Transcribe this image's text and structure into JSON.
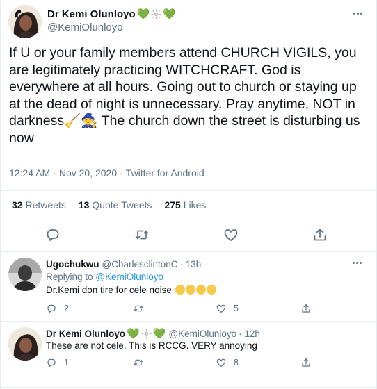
{
  "main_tweet": {
    "author_name": "Dr Kemi Olunloyo",
    "author_handle": "@KemiOlunloyo",
    "text": "If U or your family members attend CHURCH VIGILS, you are legitimately practicing WITCHCRAFT. God is everywhere at all hours. Going out to church or staying up at the dead of night is unnecessary. Pray anytime, NOT in darkness🧹🧙 The church down the street is disturbing us now",
    "time": "12:24 AM",
    "date": "Nov 20, 2020",
    "separator": "·",
    "source": "Twitter for Android",
    "stats": {
      "retweets_count": "32",
      "retweets_label": "Retweets",
      "quotes_count": "13",
      "quotes_label": "Quote Tweets",
      "likes_count": "275",
      "likes_label": "Likes"
    }
  },
  "replies": [
    {
      "author_name": "Ugochukwu",
      "author_handle": "@CharlesclintonC",
      "time": "· 13h",
      "replying_prefix": "Replying to",
      "replying_handle": "@KemiOlunloyo",
      "text": "Dr.Kemi don tire for cele noise",
      "reply_count": "2",
      "retweet_count": "",
      "like_count": "5"
    },
    {
      "author_name": "Dr Kemi Olunloyo",
      "author_handle": "@KemiOlunloyo",
      "time": "· 12h",
      "text": "These are not cele. This is RCCG. VERY annoying",
      "reply_count": "1",
      "retweet_count": "",
      "like_count": "8"
    }
  ],
  "colors": {
    "accent": "#1b95e0",
    "secondary_text": "#5b7083",
    "divider": "#e6ecf0",
    "heart_emoji": "#5fa73c"
  },
  "icons": [
    "reply-icon",
    "retweet-icon",
    "like-icon",
    "share-icon",
    "more-icon"
  ]
}
